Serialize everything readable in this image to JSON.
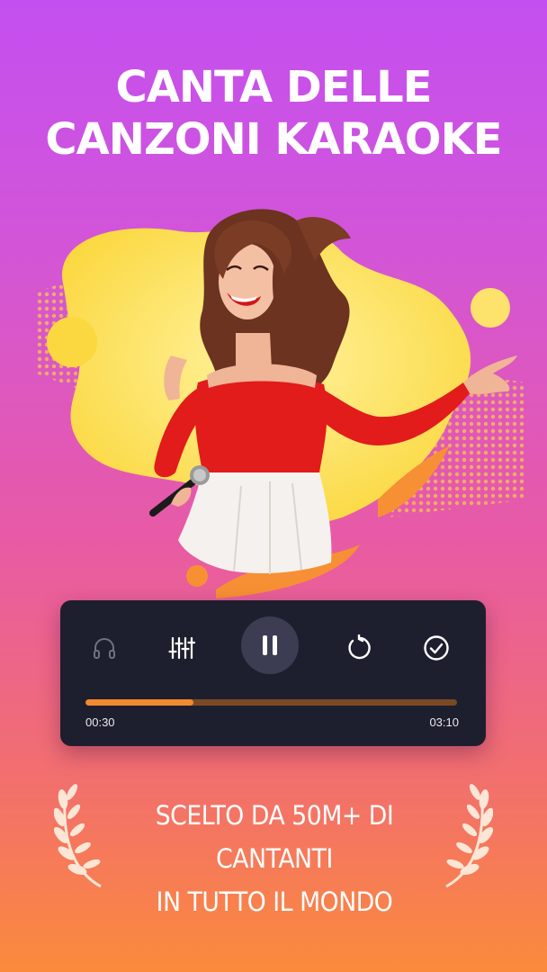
{
  "headline": {
    "line1": "CANTA DELLE",
    "line2": "CANZONI KARAOKE"
  },
  "player": {
    "controls": [
      "headphones-icon",
      "equalizer-icon",
      "pause-icon",
      "replay-icon",
      "check-circle-icon"
    ],
    "progress": 0.29,
    "time_current": "00:30",
    "time_total": "03:10",
    "colors": {
      "panel": "#1e1f2e",
      "progress": "#f28a2e",
      "track": "#7a4a24"
    }
  },
  "award": {
    "line1": "SCELTO DA 50M+ DI CANTANTI",
    "line2": "IN TUTTO IL MONDO"
  }
}
